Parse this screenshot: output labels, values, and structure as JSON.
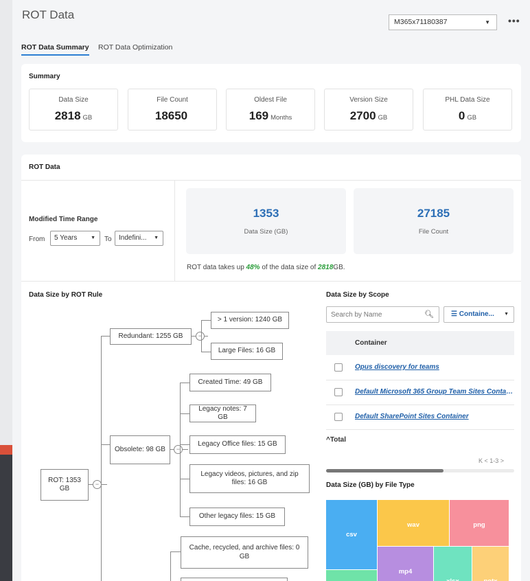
{
  "app": {
    "title": "ROT Data",
    "tenant": "M365x71180387",
    "more": "•••"
  },
  "tabs": [
    "ROT Data Summary",
    "ROT Data Optimization"
  ],
  "summary": {
    "heading": "Summary",
    "stats": [
      {
        "label": "Data Size",
        "value": "2818",
        "unit": "GB"
      },
      {
        "label": "File Count",
        "value": "18650",
        "unit": ""
      },
      {
        "label": "Oldest File",
        "value": "169",
        "unit": "Months"
      },
      {
        "label": "Version Size",
        "value": "2700",
        "unit": "GB"
      },
      {
        "label": "PHL Data Size",
        "value": "0",
        "unit": "GB"
      }
    ]
  },
  "rot": {
    "heading": "ROT Data",
    "time_range": {
      "label": "Modified Time Range",
      "from_label": "From",
      "from_value": "5 Years",
      "to_label": "To",
      "to_value": "Indefini..."
    },
    "kpis": [
      {
        "value": "1353",
        "label": "Data Size (GB)"
      },
      {
        "value": "27185",
        "label": "File Count"
      }
    ],
    "note": {
      "prefix": "ROT data takes up ",
      "pct": "48%",
      "mid": " of the data size of ",
      "total": "2818",
      "suffix": "GB."
    }
  },
  "by_rule": {
    "heading": "Data Size by ROT Rule",
    "root": "ROT: 1353 GB",
    "redundant": "Redundant: 1255 GB",
    "redundant_children": [
      "> 1 version: 1240 GB",
      "Large Files: 16 GB"
    ],
    "obsolete": "Obsolete: 98 GB",
    "obsolete_children": [
      "Created Time: 49 GB",
      "Legacy notes: 7 GB",
      "Legacy Office files: 15 GB",
      "Legacy videos, pictures, and zip files: 16 GB",
      "Other legacy files: 15 GB"
    ],
    "trivial_children": [
      "Cache, recycled, and archive files: 0 GB",
      ""
    ]
  },
  "by_scope": {
    "heading": "Data Size by Scope",
    "search_placeholder": "Search by Name",
    "container_button": "Containe...",
    "column": "Container",
    "rows": [
      "Opus discovery for teams",
      "Default Microsoft 365 Group Team Sites Container",
      "Default SharePoint Sites Container"
    ],
    "total": "^Total",
    "pager": "K  <  1-3  >"
  },
  "by_type": {
    "heading": "Data Size (GB) by File Type",
    "tiles": [
      {
        "label": "csv",
        "color": "#4aaef2"
      },
      {
        "label": "wav",
        "color": "#fbc74a"
      },
      {
        "label": "png",
        "color": "#f7909c"
      },
      {
        "label": "mp4",
        "color": "#b78ee0"
      },
      {
        "label": "xlsx",
        "color": "#6fe3c0"
      },
      {
        "label": "potx",
        "color": "#fdd078"
      },
      {
        "label": "",
        "color": "#6fe3a8"
      }
    ]
  }
}
